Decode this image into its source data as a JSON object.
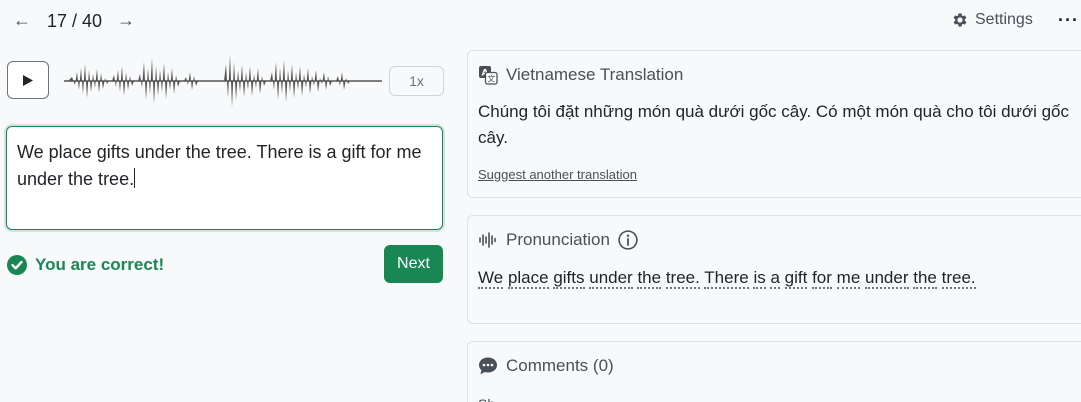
{
  "nav": {
    "prev_icon": "arrow-left-icon",
    "next_icon": "arrow-right-icon",
    "prev_glyph": "←",
    "next_glyph": "→",
    "counter": "17 / 40",
    "settings_label": "Settings",
    "more_glyph": "···"
  },
  "player": {
    "play_icon": "play-icon",
    "speed_label": "1x"
  },
  "answer": {
    "text": "We place gifts under the tree. There is a gift for me under the tree."
  },
  "result": {
    "message": "You are correct!",
    "next_label": "Next",
    "color": "#198754"
  },
  "translation": {
    "title": "Vietnamese Translation",
    "text": "Chúng tôi đặt những món quà dưới gốc cây. Có một món quà cho tôi dưới gốc cây.",
    "suggest_label": "Suggest another translation"
  },
  "pronunciation": {
    "title": "Pronunciation",
    "words": [
      "We",
      "place",
      "gifts",
      "under",
      "the",
      "tree.",
      "There",
      "is",
      "a",
      "gift",
      "for",
      "me",
      "under",
      "the",
      "tree."
    ]
  },
  "comments": {
    "title": "Comments (0)",
    "sub": "Sh"
  }
}
